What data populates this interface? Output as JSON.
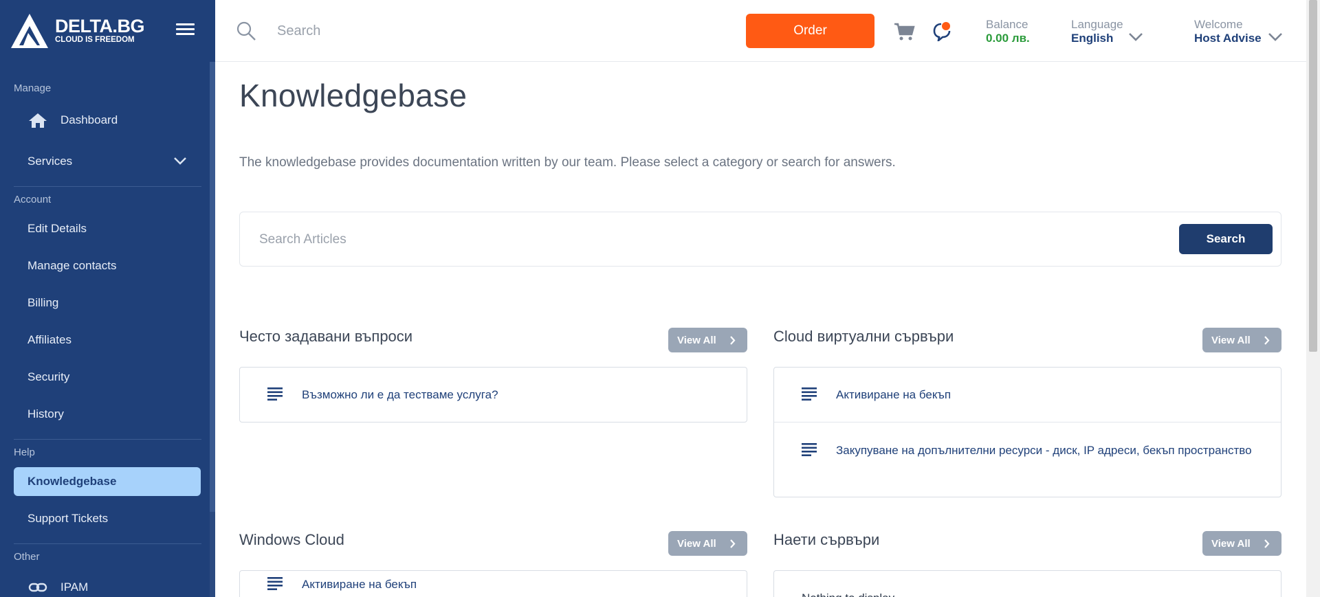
{
  "brand": {
    "name": "DELTA.BG",
    "tagline": "CLOUD IS FREEDOM"
  },
  "sidebar": {
    "sections": [
      {
        "label": "Manage"
      },
      {
        "label": "Account"
      },
      {
        "label": "Help"
      },
      {
        "label": "Other"
      }
    ],
    "items": [
      {
        "label": "Dashboard",
        "icon": "home-icon"
      },
      {
        "label": "Services",
        "icon": "chevron-down-icon"
      },
      {
        "label": "Edit Details"
      },
      {
        "label": "Manage contacts"
      },
      {
        "label": "Billing"
      },
      {
        "label": "Affiliates"
      },
      {
        "label": "Security"
      },
      {
        "label": "History"
      },
      {
        "label": "Knowledgebase",
        "active": true
      },
      {
        "label": "Support Tickets"
      },
      {
        "label": "IPAM",
        "icon": "link-icon"
      }
    ]
  },
  "topbar": {
    "search_placeholder": "Search",
    "order_label": "Order",
    "balance_label": "Balance",
    "balance_value": "0.00 лв.",
    "language_label": "Language",
    "language_value": "English",
    "welcome_label": "Welcome",
    "welcome_value": "Host Advise"
  },
  "main": {
    "title": "Knowledgebase",
    "intro": "The knowledgebase provides documentation written by our team. Please select a category or search for answers.",
    "search_placeholder": "Search Articles",
    "search_button": "Search",
    "view_all_label": "View All",
    "categories": [
      {
        "title": "Често задавани въпроси",
        "articles": [
          "Възможно ли е да тестваме услуга?"
        ]
      },
      {
        "title": "Cloud виртуални сървъри",
        "articles": [
          "Активиране на бекъп",
          "Закупуване на допълнителни ресурси - диск, IP адреси, бекъп пространство"
        ]
      },
      {
        "title": "Windows Cloud",
        "articles": [
          "Активиране на бекъп"
        ]
      },
      {
        "title": "Наети сървъри",
        "empty_text": "Nothing to display"
      }
    ]
  },
  "colors": {
    "sidebar": "#1f4079",
    "accent_orange": "#ff5a14",
    "primary_button": "#1f3d6e",
    "active_item": "#a7d2fb",
    "balance_green": "#2a9b3a"
  }
}
